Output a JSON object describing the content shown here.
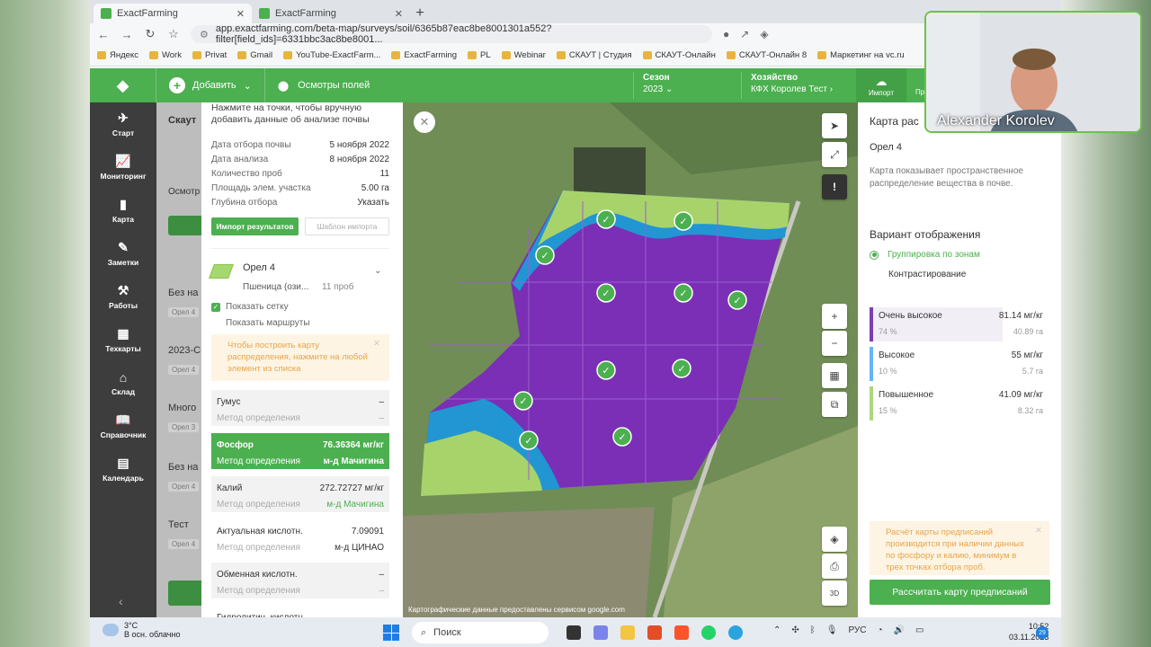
{
  "browser": {
    "tabs": [
      {
        "title": "ExactFarming"
      },
      {
        "title": "ExactFarming"
      }
    ],
    "url": "app.exactfarming.com/beta-map/surveys/soil/6365b87eac8be8001301a552?filter[field_ids]=6331bbc3ac8be8001...",
    "bookmarks": [
      "Яндекс",
      "Work",
      "Privat",
      "Gmail",
      "YouTube-ExactFarm...",
      "ExactFarming",
      "PL",
      "Webinar",
      "СКАУТ | Студия",
      "СКАУТ-Онлайн",
      "СКАУТ-Онлайн 8",
      "Маркетинг на vc.ru"
    ]
  },
  "topbar": {
    "add": "Добавить",
    "inspections": "Осмотры полей",
    "season_label": "Сезон",
    "season_value": "2023",
    "farm_label": "Хозяйство",
    "farm_value": "КФХ Королев Тест",
    "import": "Импорт",
    "more": "Пр"
  },
  "sidenav": [
    {
      "icon": "rocket-icon",
      "glyph": "✈",
      "label": "Старт"
    },
    {
      "icon": "chart-icon",
      "glyph": "📈",
      "label": "Мониторинг"
    },
    {
      "icon": "map-icon",
      "glyph": "▮",
      "label": "Карта"
    },
    {
      "icon": "notes-icon",
      "glyph": "✎",
      "label": "Заметки"
    },
    {
      "icon": "works-icon",
      "glyph": "⚒",
      "label": "Работы"
    },
    {
      "icon": "techcards-icon",
      "glyph": "▦",
      "label": "Техкарты"
    },
    {
      "icon": "warehouse-icon",
      "glyph": "⌂",
      "label": "Склад"
    },
    {
      "icon": "reference-icon",
      "glyph": "📖",
      "label": "Справочник"
    },
    {
      "icon": "calendar-icon",
      "glyph": "▤",
      "label": "Календарь"
    }
  ],
  "list": {
    "title": "Скаут",
    "items": [
      "Без на",
      "2023-С",
      "Много",
      "Без на",
      "Тест"
    ],
    "subs": [
      "Орел 4",
      "Орел 4",
      "Орел 3",
      "Орел 4",
      "Орел 4"
    ],
    "osmotr": "Осмотр"
  },
  "survey": {
    "intro": "Нажмите на точки, чтобы вручную добавить данные об анализе почвы",
    "rows": [
      {
        "k": "Дата отбора почвы",
        "v": "5 ноября 2022"
      },
      {
        "k": "Дата анализа",
        "v": "8 ноября 2022"
      },
      {
        "k": "Количество проб",
        "v": "11"
      },
      {
        "k": "Площадь элем. участка",
        "v": "5.00 га"
      },
      {
        "k": "Глубина отбора",
        "v": "Указать"
      }
    ],
    "btn_import": "Импорт результатов",
    "btn_template": "Шаблон импорта",
    "field": {
      "name": "Орел 4",
      "crop": "Пшеница (ози...",
      "probes": "11 проб"
    },
    "show_grid": "Показать сетку",
    "show_routes": "Показать маршруты",
    "hint": "Чтобы построить карту распределения, нажмите на любой элемент из списка",
    "indicators": [
      {
        "name": "Гумус",
        "value": "–",
        "method": "Метод определения",
        "mval": "–"
      },
      {
        "name": "Фосфор",
        "value": "76.36364 мг/кг",
        "method": "Метод определения",
        "mval": "м-д Мачигина"
      },
      {
        "name": "Калий",
        "value": "272.72727 мг/кг",
        "method": "Метод определения",
        "mval": "м-д Мачигина"
      },
      {
        "name": "Актуальная кислотн.",
        "value": "7.09091",
        "method": "Метод определения",
        "mval": "м-д ЦИНАО"
      },
      {
        "name": "Обменная кислотн.",
        "value": "–",
        "method": "Метод определения",
        "mval": "–"
      },
      {
        "name": "Гидролитич. кислотн.",
        "value": "",
        "method": "",
        "mval": ""
      }
    ]
  },
  "map": {
    "credit": "Картографические данные предоставлены сервисом google.com"
  },
  "right": {
    "title": "Карта рас",
    "field": "Орел 4",
    "desc": "Карта показывает пространственное распределение вещества в почве.",
    "variant": "Вариант отображения",
    "opt1": "Группировка по зонам",
    "opt2": "Контрастирование",
    "zones": [
      {
        "name": "Очень высокое",
        "pct": "74 %",
        "val": "81.14 мг/кг",
        "area": "40.89 га",
        "color": "#7b3fb0"
      },
      {
        "name": "Высокое",
        "pct": "10 %",
        "val": "55 мг/кг",
        "area": "5.7 га",
        "color": "#64b5f6"
      },
      {
        "name": "Повышенное",
        "pct": "15 %",
        "val": "41.09 мг/кг",
        "area": "8.32 га",
        "color": "#aed581"
      }
    ],
    "warn": "Расчёт карты предписаний производится при наличии данных по фосфору и калию, минимум в трех точках отбора проб.",
    "btn": "Рассчитать карту предписаний"
  },
  "taskbar": {
    "temp": "3°C",
    "weather": "В осн. облачно",
    "search": "Поиск",
    "lang": "РУС",
    "time": "10:52",
    "date": "03.11.2023",
    "badge": "29"
  },
  "camera": {
    "name": "Alexander Korolev"
  }
}
